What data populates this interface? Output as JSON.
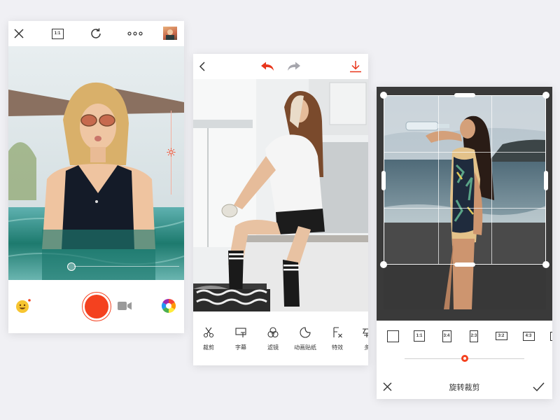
{
  "camera": {
    "ratio_label": "1:1",
    "accent_color": "#f4411f"
  },
  "editor": {
    "tools": [
      {
        "label": "裁剪",
        "icon": "scissors-icon"
      },
      {
        "label": "字幕",
        "icon": "subtitle-icon"
      },
      {
        "label": "滤镜",
        "icon": "filter-icon"
      },
      {
        "label": "动画贴纸",
        "icon": "sticker-icon"
      },
      {
        "label": "特效",
        "icon": "effects-icon"
      },
      {
        "label": "多",
        "icon": "more-tool-icon"
      }
    ],
    "undo_color": "#e8361c"
  },
  "crop": {
    "title": "旋转裁剪",
    "ratios": [
      "",
      "1:1",
      "3:4",
      "2:3",
      "3:2",
      "4:3"
    ],
    "slider_value": 0.5
  }
}
